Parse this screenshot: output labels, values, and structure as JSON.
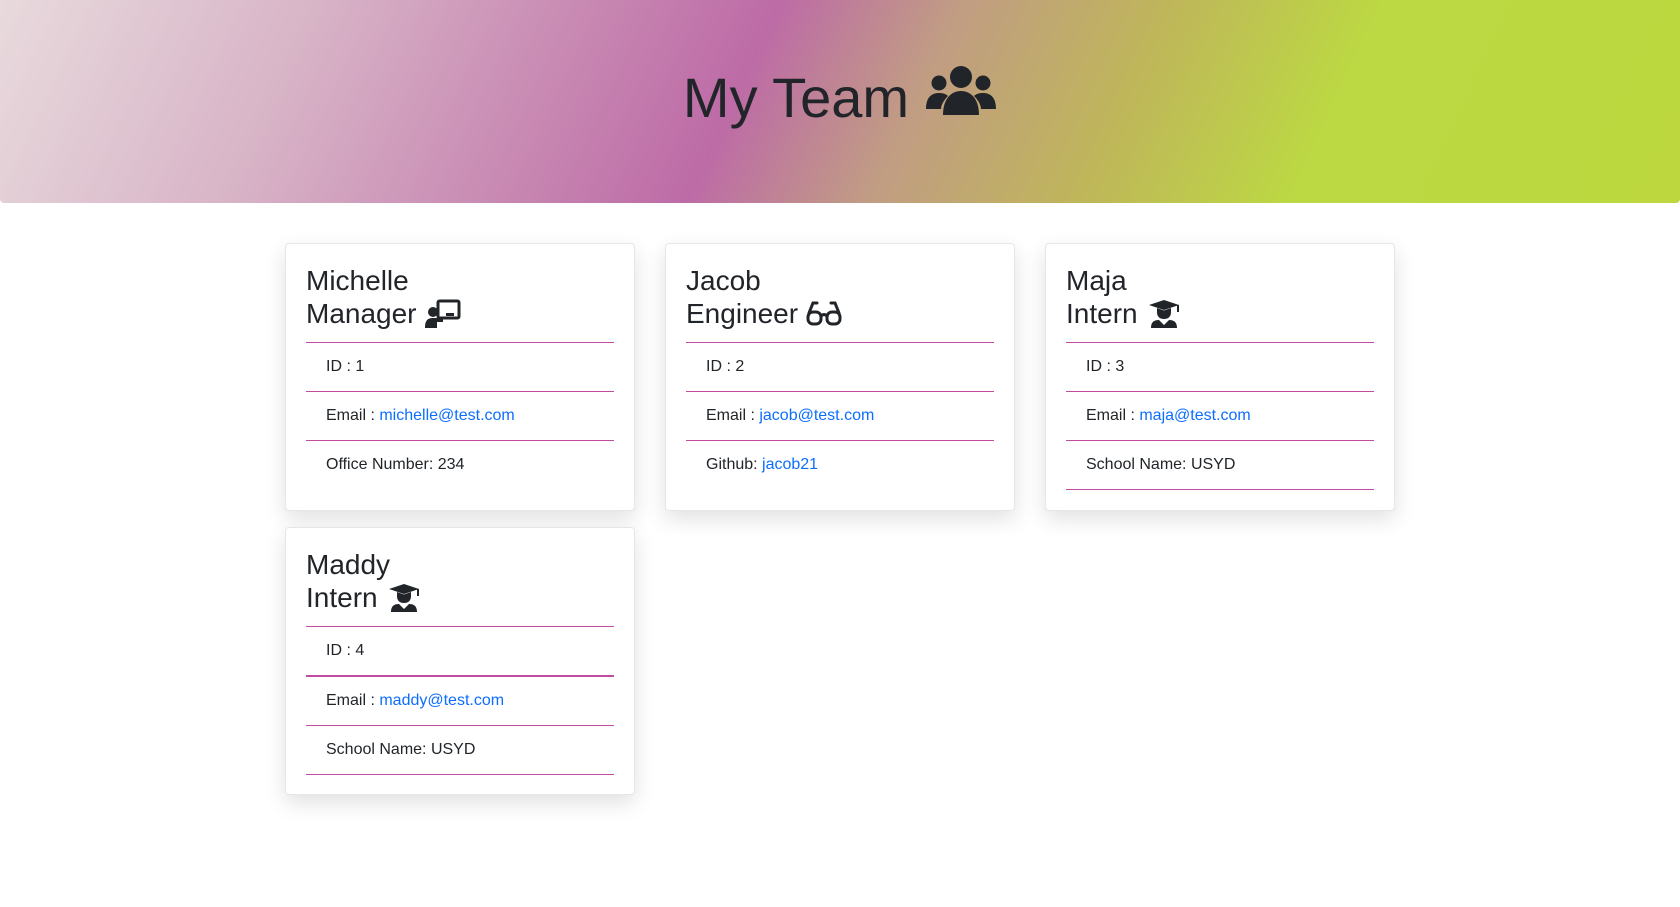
{
  "header": {
    "title": "My Team",
    "icon": "users-icon"
  },
  "cards": [
    {
      "name": "Michelle",
      "role": "Manager",
      "role_icon": "chalkboard-teacher-icon",
      "id_label": "ID : ",
      "id": "1",
      "email_label": "Email : ",
      "email": "michelle@test.com",
      "extra_label": "Office Number: ",
      "extra_value": "234"
    },
    {
      "name": "Jacob",
      "role": "Engineer",
      "role_icon": "glasses-icon",
      "id_label": "ID : ",
      "id": "2",
      "email_label": "Email : ",
      "email": "jacob@test.com",
      "extra_label": "Github: ",
      "extra_value": "jacob21"
    },
    {
      "name": "Maja",
      "role": "Intern",
      "role_icon": "graduate-icon",
      "id_label": "ID : ",
      "id": "3",
      "email_label": "Email : ",
      "email": "maja@test.com",
      "extra_label": "School Name: ",
      "extra_value": "USYD"
    },
    {
      "name": "Maddy",
      "role": "Intern",
      "role_icon": "graduate-icon",
      "id_label": "ID : ",
      "id": "4",
      "email_label": "Email : ",
      "email": "maddy@test.com",
      "extra_label": "School Name: ",
      "extra_value": "USYD"
    }
  ],
  "colors": {
    "divider": "#c24ca3",
    "link": "#0d6efd",
    "gradient_start": "#e8dadd",
    "gradient_mid": "#bd6ba6",
    "gradient_end": "#bcd83e"
  }
}
